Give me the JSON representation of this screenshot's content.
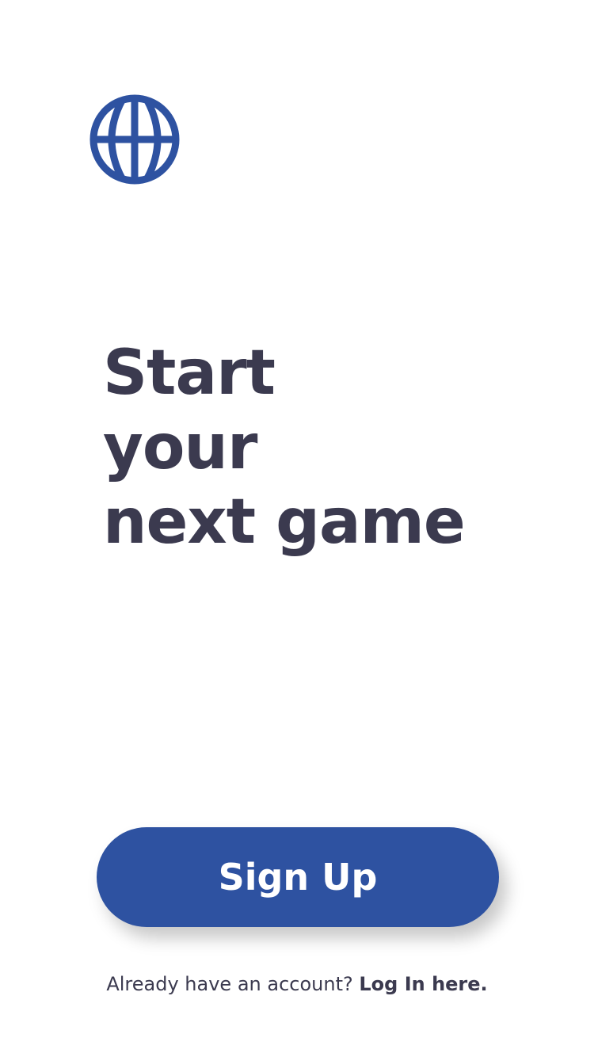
{
  "brand": {
    "logo_icon": "basketball-icon",
    "accent_color": "#2e52a1"
  },
  "hero": {
    "line1": "Start",
    "line2": "your",
    "line3": "next game"
  },
  "actions": {
    "signup_label": "Sign Up"
  },
  "login": {
    "prompt": "Already have an account?",
    "link_label": "Log In here."
  },
  "colors": {
    "text": "#3b3a4f",
    "background": "#ffffff",
    "button": "#2e52a1",
    "button_text": "#ffffff"
  }
}
